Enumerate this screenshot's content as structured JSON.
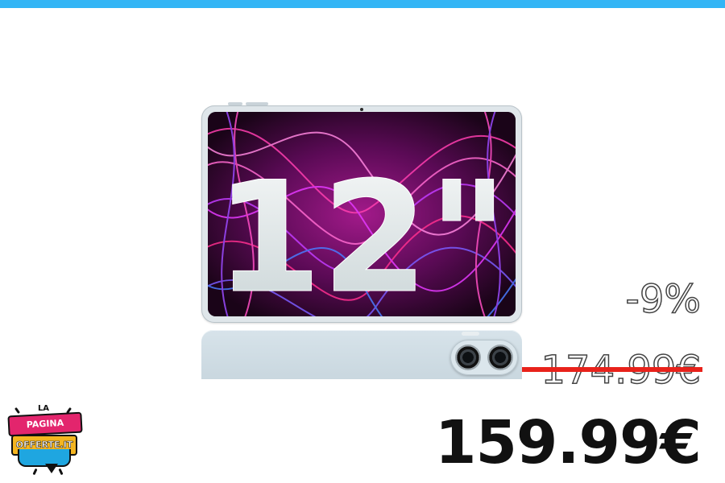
{
  "product": {
    "screen_text": "12\"",
    "image_icon": "tablet-image"
  },
  "prices": {
    "discount": "-9%",
    "original_price": "174.99€",
    "sale_price": "159.99€"
  },
  "logo": {
    "top": "LA",
    "line1": "PAGINA DELLE",
    "line2": "OFFERTE.IT"
  },
  "colors": {
    "top_bar": "#33b5f5",
    "strike": "#e8221b",
    "sale_price": "#111111",
    "logo_pink": "#e3256d",
    "logo_yellow": "#f4b520",
    "logo_blue": "#1fa6e0"
  }
}
